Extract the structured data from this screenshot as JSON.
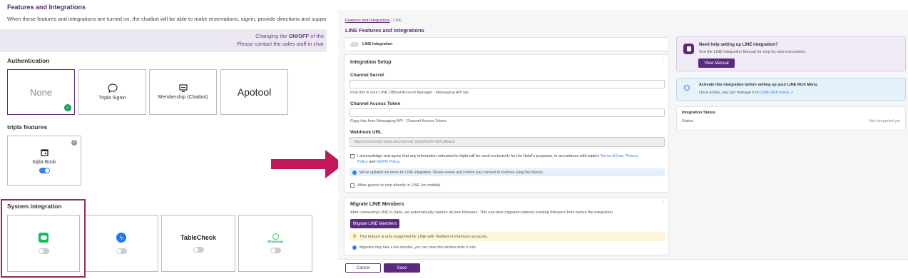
{
  "left": {
    "title": "Features and Integrations",
    "description": "When these features and integrations are turned on, the chatbot will be able to make reservations, signin, provide directions and support tic",
    "banner_line1_pre": "Changing the ",
    "banner_line1_bold": "ON/OFF",
    "banner_line1_post": " of the",
    "banner_line2": "Please contact the sales staff in char",
    "auth_heading": "Authentication",
    "auth_cards": {
      "none": "None",
      "signin": "Tripla Signin",
      "membership": "Membership (Chatbot)",
      "apotool": "Apotool"
    },
    "features_heading": "tripla features",
    "tripla_book": "tripla Book",
    "system_heading": "System integration",
    "tablecheck": "TableCheck",
    "whatsapp": "WhatsApp"
  },
  "right": {
    "breadcrumb_link": "Features and Integrations",
    "breadcrumb_sep": "/",
    "breadcrumb_current": "LINE",
    "page_title": "LINE Features and Integrations",
    "line_integration_label": "LINE Integration",
    "setup": {
      "title": "Integration Setup",
      "channel_secret_label": "Channel Secret",
      "channel_secret_help": "Find this in your LINE Official Account Manager - Messaging API tab.",
      "channel_token_label": "Channel Access Token",
      "channel_token_help": "Copy this from Messaging API - Channel Access Token.",
      "webhook_label": "Webhook URL",
      "webhook_value": "https://concierge.tripla.ai/universal_bots/line/5766/callback",
      "agree_text_1": "I acknowledge and agree that any information entrusted to tripla will be used exclusively for the Hotel's purposes, in accordance with tripla's ",
      "terms_link": "Terms of Use",
      "agree_text_2": ", ",
      "privacy_link_a": "Privacy",
      "privacy_link_b": "Policy",
      "agree_text_3": " and ",
      "gdpr_link": "GDPR Policy",
      "agree_text_4": ".",
      "info_text": "We've updated our terms for LINE integration. Please review and confirm your consent to continue using this feature.",
      "allow_guests": "Allow guests to chat directly in LINE (on mobile)"
    },
    "migrate": {
      "title": "Migrate LINE Members",
      "description": "After connecting LINE to tripla, we automatically capture all new followers. This one-time migration imports existing followers from before the integration.",
      "button": "Migrate LINE Members",
      "warning": "This feature is only supported for LINE with Verified or Premium accounts.",
      "note": "Migration may take a few minutes, you can close this window while it runs."
    },
    "help": {
      "title": "Need help setting up LINE integration?",
      "text": "See the LINE Integration Manual for step-by-step instructions.",
      "button": "View Manual"
    },
    "activate": {
      "title": "Activate this integration before setting up your LINE Rich Menu.",
      "text_pre": "Once active, you can manage it on ",
      "link": "LINE Rich menu"
    },
    "status": {
      "title": "Integration Status",
      "label": "Status",
      "value": "Not integrated yet"
    },
    "footer": {
      "cancel": "Cancel",
      "save": "Save"
    }
  },
  "colors": {
    "brand_purple": "#5b2a7e",
    "link_blue": "#2f7ff2",
    "line_green": "#06c755",
    "arrow": "#c2185b",
    "highlight_border": "#9a2a55"
  }
}
